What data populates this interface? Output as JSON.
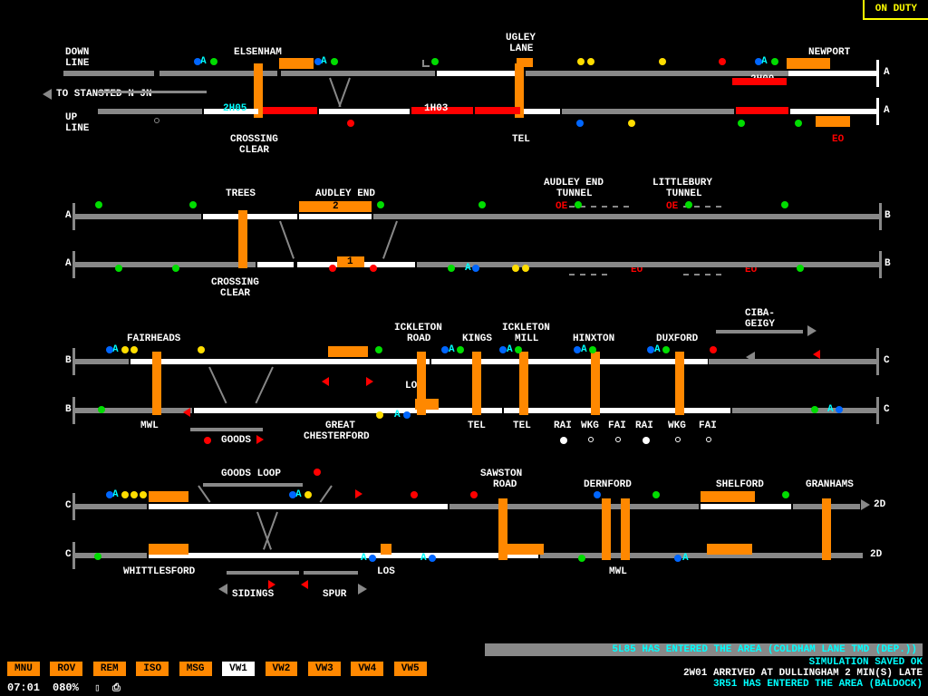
{
  "duty": "ON DUTY",
  "labels": {
    "down_line1": "DOWN",
    "down_line2": "LINE",
    "up_line1": "UP",
    "up_line2": "LINE",
    "elsenham": "ELSENHAM",
    "ugley1": "UGLEY",
    "ugley2": "LANE",
    "newport": "NEWPORT",
    "stansted": "TO STANSTED N JN",
    "crossing1": "CROSSING",
    "clear1": "CLEAR",
    "crossing2": "CROSSING",
    "clear2": "CLEAR",
    "tel1": "TEL",
    "eo1": "EO",
    "trees": "TREES",
    "audley_end": "AUDLEY END",
    "ae_tunnel1": "AUDLEY END",
    "ae_tunnel2": "TUNNEL",
    "lit_tunnel1": "LITTLEBURY",
    "lit_tunnel2": "TUNNEL",
    "oe1": "OE",
    "oe2": "OE",
    "eo2": "EO",
    "eo3": "EO",
    "fairheads": "FAIRHEADS",
    "ick_road1": "ICKLETON",
    "ick_road2": "ROAD",
    "kings": "KINGS",
    "ick_mill1": "ICKLETON",
    "ick_mill2": "MILL",
    "hinxton": "HINXTON",
    "duxford": "DUXFORD",
    "ciba1": "CIBA-",
    "ciba2": "GEIGY",
    "mwl": "MWL",
    "goods": "GOODS",
    "gt_chest1": "GREAT",
    "gt_chest2": "CHESTERFORD",
    "los1": "LOS",
    "tel2": "TEL",
    "tel3": "TEL",
    "rai1": "RAI",
    "wkg1": "WKG",
    "fai1": "FAI",
    "rai2": "RAI",
    "wkg2": "WKG",
    "fai2": "FAI",
    "goods_loop": "GOODS LOOP",
    "sawston1": "SAWSTON",
    "sawston2": "ROAD",
    "dernford": "DERNFORD",
    "shelford": "SHELFORD",
    "granhams": "GRANHAMS",
    "whittlesford": "WHITTLESFORD",
    "los2": "LOS",
    "mwl2": "MWL",
    "sidings": "SIDINGS",
    "spur": "SPUR",
    "twod": "2D",
    "twod2": "2D",
    "plat2": "2",
    "plat1": "1",
    "a_cyan1": "A",
    "a_cyan2": "A",
    "a_cyan3": "A",
    "a_cyan4": "A",
    "a_cyan5": "A",
    "a_cyan6": "A",
    "a_cyan7": "A",
    "a_cyan8": "A",
    "a_cyan9": "A",
    "a_cyan10": "A",
    "a_cyan11": "A",
    "a_cyan12": "A",
    "a_cyan13": "A",
    "a_cyan14": "A",
    "a_cyan15": "A"
  },
  "trains": {
    "t1": "2H05",
    "t2": "1H03",
    "t3": "2H00"
  },
  "buttons": {
    "mnu": "MNU",
    "rov": "ROV",
    "rem": "REM",
    "iso": "ISO",
    "msg": "MSG",
    "vw1": "VW1",
    "vw2": "VW2",
    "vw3": "VW3",
    "vw4": "VW4",
    "vw5": "VW5"
  },
  "clock": "07:01",
  "pct": "080%",
  "messages": {
    "m1": "5L85 HAS ENTERED THE AREA (COLDHAM LANE TMD (DEP.))",
    "m2": "SIMULATION SAVED OK",
    "m3": "2W01 ARRIVED AT DULLINGHAM 2 MIN(S) LATE",
    "m4": "3R51 HAS ENTERED THE AREA (BALDOCK)"
  }
}
